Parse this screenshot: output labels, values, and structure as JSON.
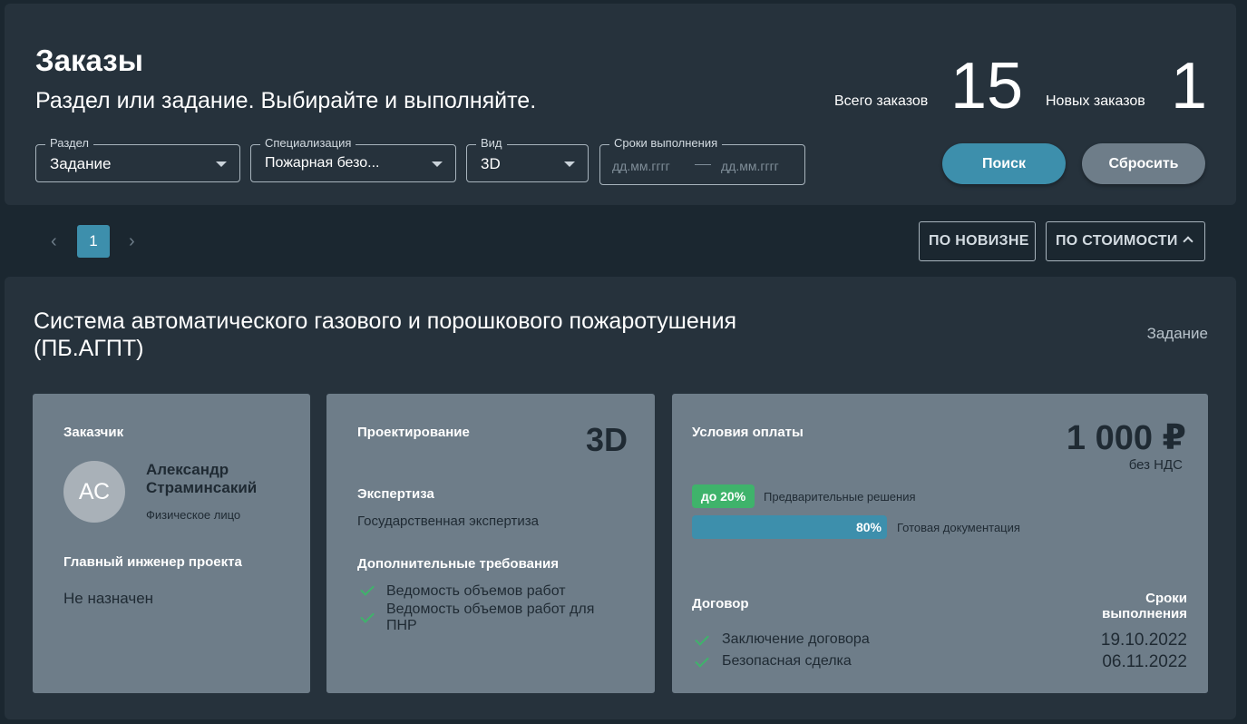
{
  "header": {
    "title": "Заказы",
    "subtitle": "Раздел или задание. Выбирайте и выполняйте.",
    "total_label": "Всего заказов",
    "total_value": "15",
    "new_label": "Новых заказов",
    "new_value": "1"
  },
  "filters": {
    "section": {
      "label": "Раздел",
      "value": "Задание"
    },
    "specialization": {
      "label": "Специализация",
      "value": "Пожарная безо..."
    },
    "view": {
      "label": "Вид",
      "value": "3D"
    },
    "deadlines": {
      "label": "Сроки выполнения",
      "from_placeholder": "дд.мм.гггг",
      "to_placeholder": "дд.мм.гггг"
    }
  },
  "buttons": {
    "search": "Поиск",
    "reset": "Сбросить"
  },
  "pagination": {
    "current": "1"
  },
  "sort": {
    "by_new": "ПО НОВИЗНЕ",
    "by_cost": "ПО СТОИМОСТИ"
  },
  "order": {
    "title": "Система автоматического газового и порошкового пожаротушения (ПБ.АГПТ)",
    "type": "Задание",
    "customer": {
      "label": "Заказчик",
      "initials": "АС",
      "name_line1": "Александр",
      "name_line2": "Страминсакий",
      "kind": "Физическое лицо",
      "engineer_label": "Главный инженер проекта",
      "engineer_value": "Не назначен"
    },
    "design": {
      "label": "Проектирование",
      "view": "3D",
      "expertise_label": "Экспертиза",
      "expertise_value": "Государственная экспертиза",
      "requirements_label": "Дополнительные требования",
      "requirements": [
        "Ведомость объемов работ",
        "Ведомость объемов работ для ПНР"
      ]
    },
    "payment": {
      "label": "Условия оплаты",
      "price": "1 000 ₽",
      "vat": "без НДС",
      "prepay_badge": "до 20%",
      "prepay_desc": "Предварительные решения",
      "docs_progress": "80%",
      "docs_desc": "Готовая документация",
      "contract_label": "Договор",
      "deadlines_label_line1": "Сроки",
      "deadlines_label_line2": "выполнения",
      "steps": [
        {
          "name": "Заключение договора",
          "date": "19.10.2022"
        },
        {
          "name": "Безопасная сделка",
          "date": "06.11.2022"
        }
      ]
    }
  },
  "colors": {
    "accent": "#3d8fac",
    "success": "#3fb36b",
    "card": "#6e7d89",
    "panel": "#26323c",
    "background": "#1b2730"
  }
}
